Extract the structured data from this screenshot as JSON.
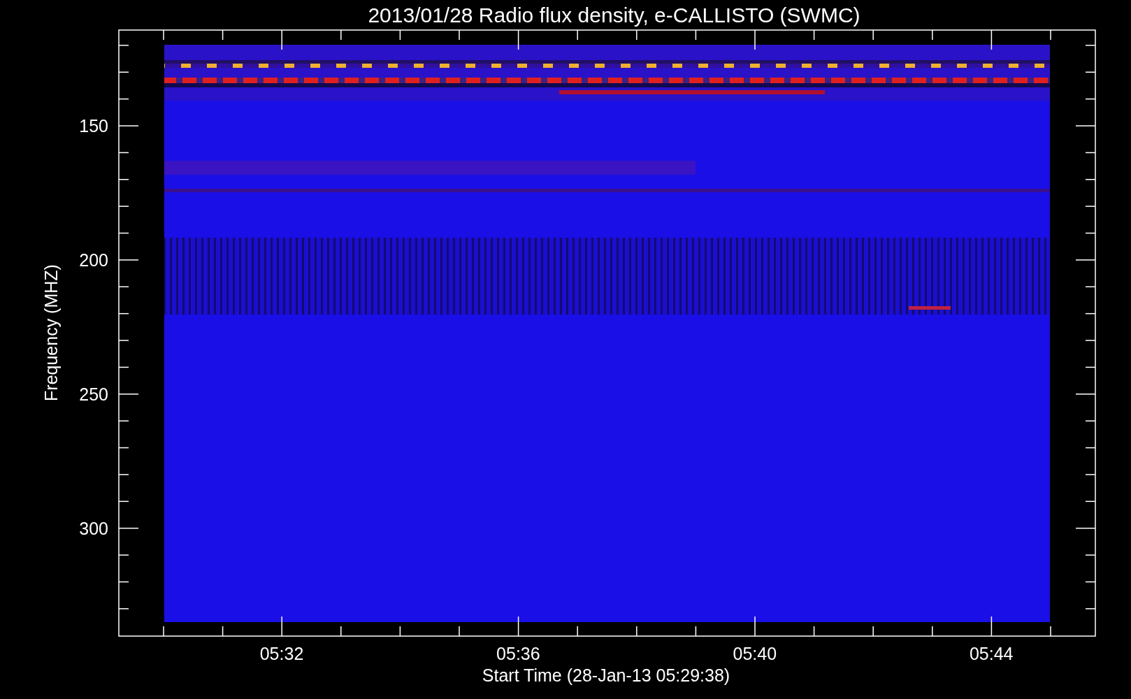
{
  "title": "2013/01/28  Radio flux density, e-CALLISTO (SWMC)",
  "y_axis": {
    "label": "Frequency (MHZ)",
    "ticks": [
      "150",
      "200",
      "250",
      "300"
    ]
  },
  "x_axis": {
    "label": "Start Time (28-Jan-13 05:29:38)",
    "ticks": [
      "05:32",
      "05:36",
      "05:40",
      "05:44"
    ]
  }
}
